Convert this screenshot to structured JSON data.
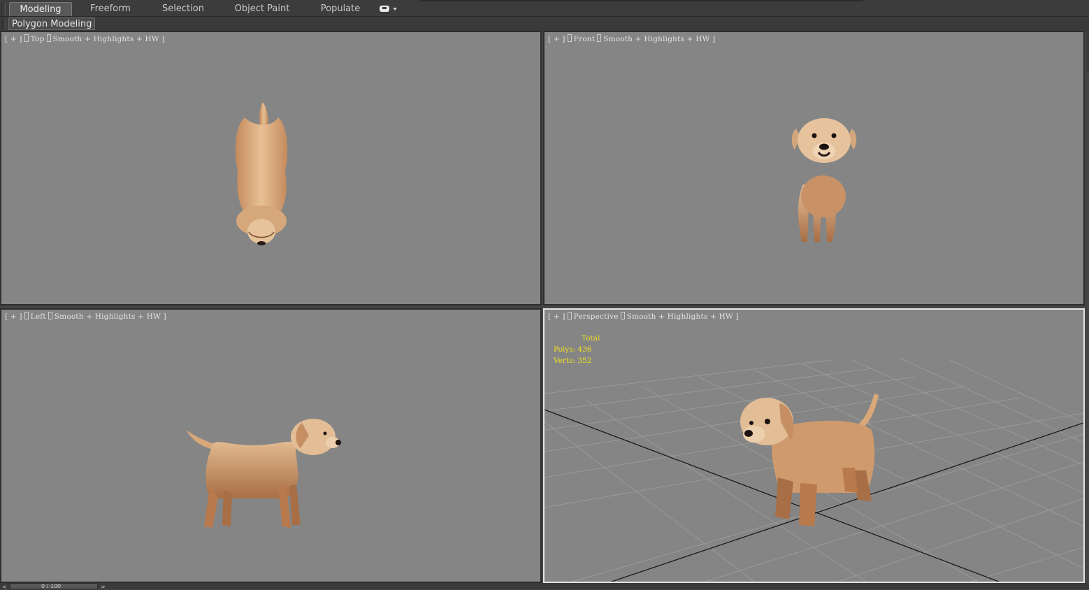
{
  "ribbon": {
    "tabs": [
      {
        "label": "Modeling",
        "active": true
      },
      {
        "label": "Freeform",
        "active": false
      },
      {
        "label": "Selection",
        "active": false
      },
      {
        "label": "Object Paint",
        "active": false
      },
      {
        "label": "Populate",
        "active": false
      }
    ],
    "menu_icon": "ribbon-options-icon"
  },
  "panel": {
    "label": "Polygon Modeling"
  },
  "viewports": {
    "top": {
      "plus": "[ + ]",
      "view": "Top",
      "shading": "Smooth + Highlights + HW ]",
      "active": false
    },
    "front": {
      "plus": "[ + ]",
      "view": "Front",
      "shading": "Smooth + Highlights + HW ]",
      "active": false
    },
    "left": {
      "plus": "[ + ]",
      "view": "Left",
      "shading": "Smooth + Highlights + HW ]",
      "active": false
    },
    "perspective": {
      "plus": "[ + ]",
      "view": "Perspective",
      "shading": "Smooth + Highlights + HW ]",
      "active": true,
      "stats": {
        "header": "Total",
        "polys_label": "Polys:",
        "polys": "436",
        "verts_label": "Verts:",
        "verts": "352"
      }
    }
  },
  "timeline": {
    "prev": "<",
    "slider": "0 / 100",
    "next": ">"
  },
  "colors": {
    "viewport_bg": "#858585",
    "stats_text": "#f0e020",
    "dog_fur": "#d9a878",
    "dog_fur_dark": "#a86e45",
    "active_border": "#e3e3e3"
  }
}
